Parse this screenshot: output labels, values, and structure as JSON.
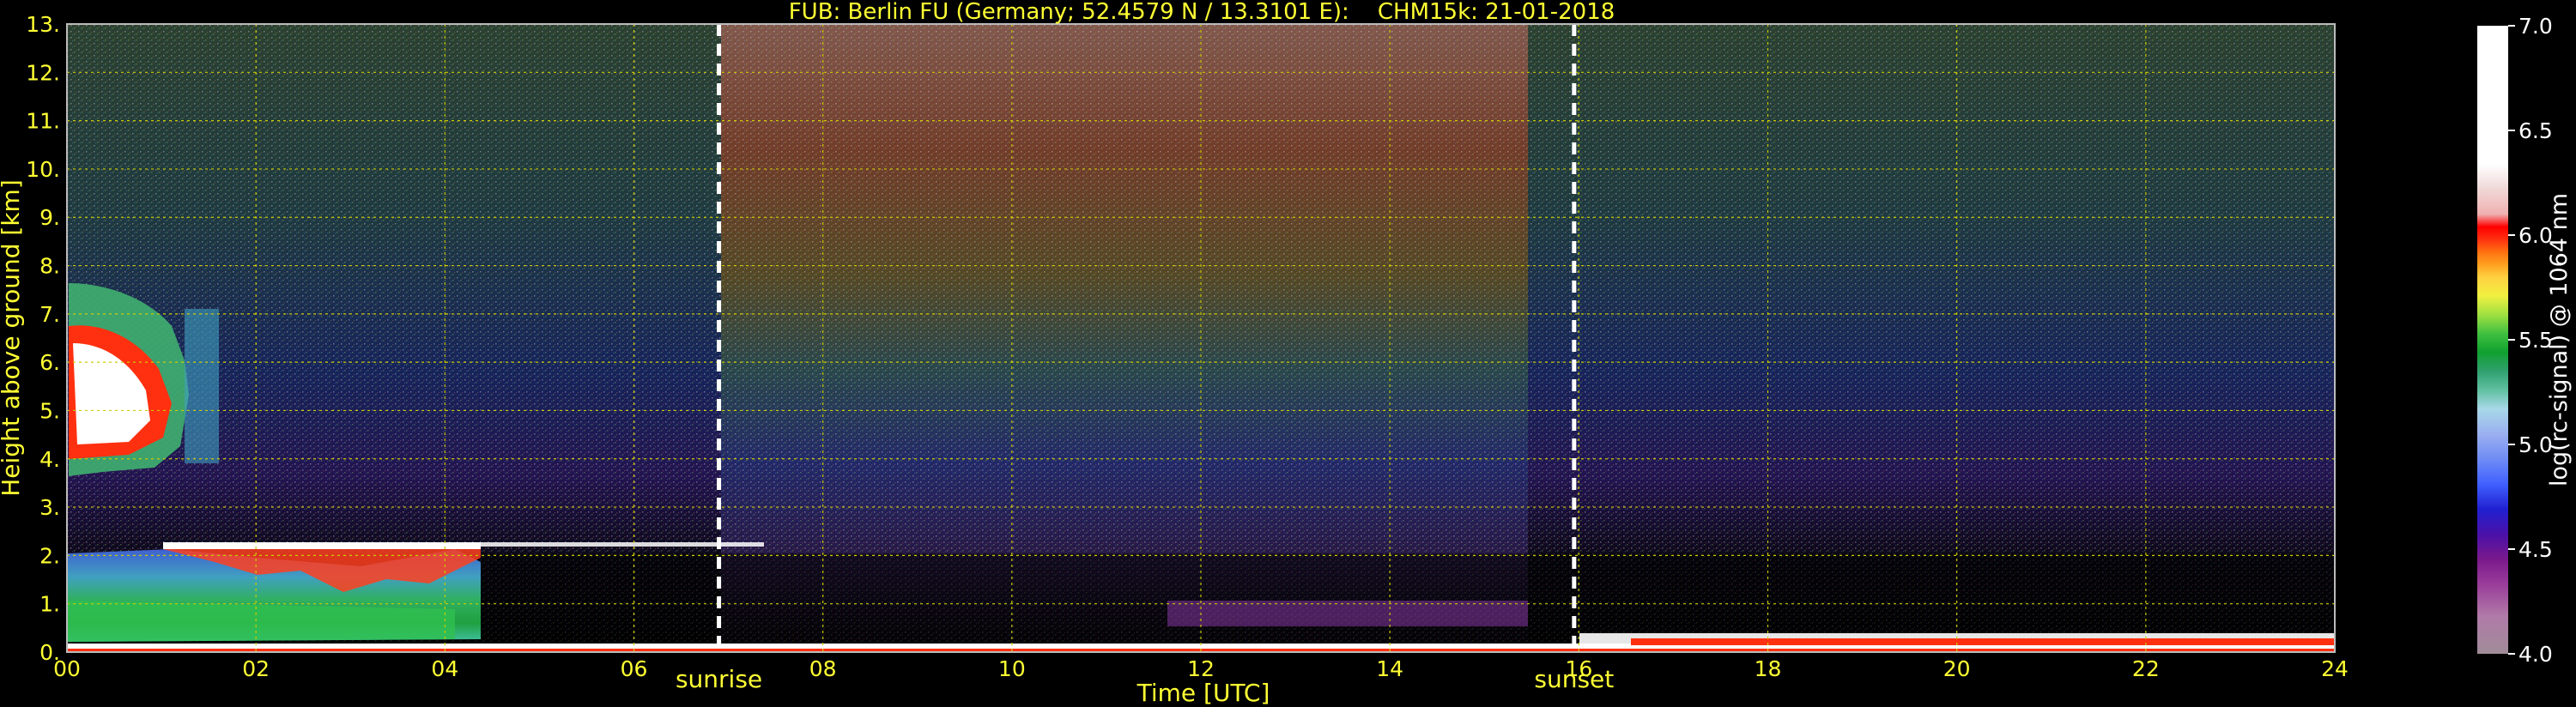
{
  "chart_data": {
    "type": "heatmap",
    "title": "FUB: Berlin FU (Germany; 52.4579 N / 13.3101 E):    CHM15k: 21-01-2018",
    "xlabel": "Time [UTC]",
    "ylabel": "Height above ground [km]",
    "xlim": [
      0,
      24
    ],
    "ylim": [
      0,
      13
    ],
    "x_ticks": [
      "00",
      "02",
      "04",
      "06",
      "08",
      "10",
      "12",
      "14",
      "16",
      "18",
      "20",
      "22",
      "24"
    ],
    "y_ticks": [
      "0.",
      "1.",
      "2.",
      "3.",
      "4.",
      "5.",
      "6.",
      "7.",
      "8.",
      "9.",
      "10.",
      "11.",
      "12.",
      "13."
    ],
    "grid": true,
    "annotations": [
      {
        "label": "sunrise",
        "x": 6.9
      },
      {
        "label": "sunset",
        "x": 15.95
      }
    ],
    "colorbar": {
      "label": "log(rc-signal) @ 1064 nm",
      "range": [
        4.0,
        7.0
      ],
      "ticks": [
        "4.0",
        "4.5",
        "5.0",
        "5.5",
        "6.0",
        "6.5",
        "7.0"
      ],
      "colors": [
        "#a08c98",
        "#b07aa8",
        "#9a3d9a",
        "#7a1a8c",
        "#4a10a8",
        "#2020d0",
        "#4060ff",
        "#6f8cf5",
        "#9ab0f0",
        "#a8d8e8",
        "#60c0a0",
        "#30a070",
        "#10a030",
        "#40c040",
        "#a0e040",
        "#f0f040",
        "#ffd040",
        "#ffa020",
        "#ff7010",
        "#ff3010",
        "#ff0000",
        "#f0b0b0",
        "#f0d8d8",
        "#ffffff",
        "#ffffff"
      ]
    }
  }
}
